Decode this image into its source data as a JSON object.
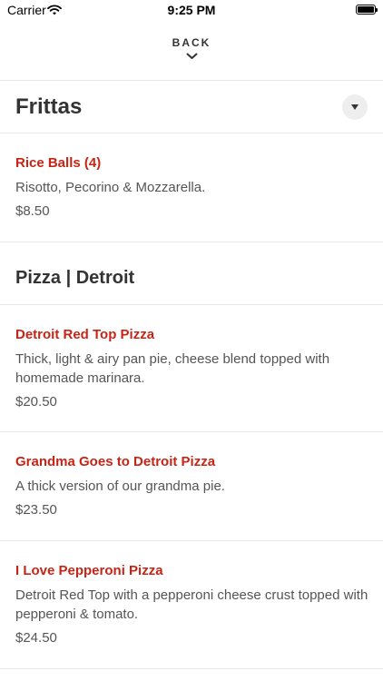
{
  "status_bar": {
    "carrier": "Carrier",
    "time": "9:25 PM"
  },
  "nav": {
    "back_label": "BACK"
  },
  "sections": [
    {
      "title": "Frittas",
      "items": [
        {
          "name": "Rice Balls (4)",
          "description": "Risotto, Pecorino & Mozzarella.",
          "price": "$8.50"
        }
      ]
    },
    {
      "title": "Pizza | Detroit",
      "items": [
        {
          "name": "Detroit Red Top Pizza",
          "description": "Thick, light & airy pan pie, cheese blend topped with homemade marinara.",
          "price": "$20.50"
        },
        {
          "name": "Grandma Goes to Detroit Pizza",
          "description": "A thick version of our grandma pie.",
          "price": "$23.50"
        },
        {
          "name": "I Love Pepperoni Pizza",
          "description": "Detroit Red Top with a pepperoni cheese crust topped with pepperoni & tomato.",
          "price": "$24.50"
        }
      ]
    }
  ],
  "colors": {
    "item_name": "#c82416",
    "text": "#555555",
    "heading": "#333333",
    "divider": "#e8e8e8"
  },
  "icons": {
    "back": "chevron-down-icon",
    "collapse": "triangle-down-icon",
    "wifi": "wifi-icon",
    "battery": "battery-icon"
  }
}
